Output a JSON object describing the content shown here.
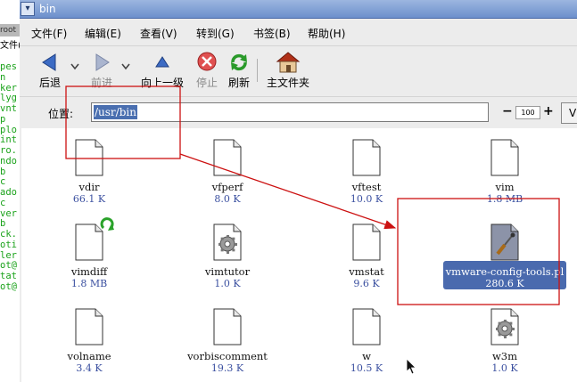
{
  "terminal": {
    "title": "root",
    "menu": "文件(F",
    "lines": [
      "pes",
      "n",
      "ker",
      "lyg",
      "vnt",
      "p",
      "plo",
      "int",
      "ro.",
      "ndo",
      "b",
      "c",
      "ado",
      "c",
      "ver",
      "b",
      "ck.",
      "oti",
      "ler",
      "ot@",
      "tat",
      "ot@"
    ]
  },
  "window": {
    "title": "bin",
    "menu": [
      "文件(F)",
      "编辑(E)",
      "查看(V)",
      "转到(G)",
      "书签(B)",
      "帮助(H)"
    ],
    "toolbar": {
      "back": "后退",
      "forward": "前进",
      "up": "向上一级",
      "stop": "停止",
      "reload": "刷新",
      "home": "主文件夹"
    },
    "location": {
      "label": "位置:",
      "value": "/usr/bin"
    },
    "zoom": {
      "value": "100",
      "minus": "−",
      "plus": "+"
    },
    "view_button_label": "V"
  },
  "files": [
    {
      "name": "vdir",
      "size": "66.1 K",
      "icon": "doc-icon"
    },
    {
      "name": "vfperf",
      "size": "8.0 K",
      "icon": "doc-icon"
    },
    {
      "name": "vftest",
      "size": "10.0 K",
      "icon": "doc-icon"
    },
    {
      "name": "vim",
      "size": "1.8 MB",
      "icon": "doc-icon"
    },
    {
      "name": "vimdiff",
      "size": "1.8 MB",
      "icon": "symlink-doc-icon"
    },
    {
      "name": "vimtutor",
      "size": "1.0 K",
      "icon": "gear-doc-icon"
    },
    {
      "name": "vmstat",
      "size": "9.6 K",
      "icon": "doc-icon"
    },
    {
      "name": "vmware-config-tools.pl",
      "size": "280.6 K",
      "icon": "script-doc-icon",
      "selected": true
    },
    {
      "name": "volname",
      "size": "3.4 K",
      "icon": "doc-icon"
    },
    {
      "name": "vorbiscomment",
      "size": "19.3 K",
      "icon": "doc-icon"
    },
    {
      "name": "w",
      "size": "10.5 K",
      "icon": "doc-icon"
    },
    {
      "name": "w3m",
      "size": "1.0 K",
      "icon": "gear-doc-icon"
    }
  ],
  "colors": {
    "annotation": "#cc1111",
    "selection": "#4a6aae",
    "size_text": "#3b50a0"
  }
}
